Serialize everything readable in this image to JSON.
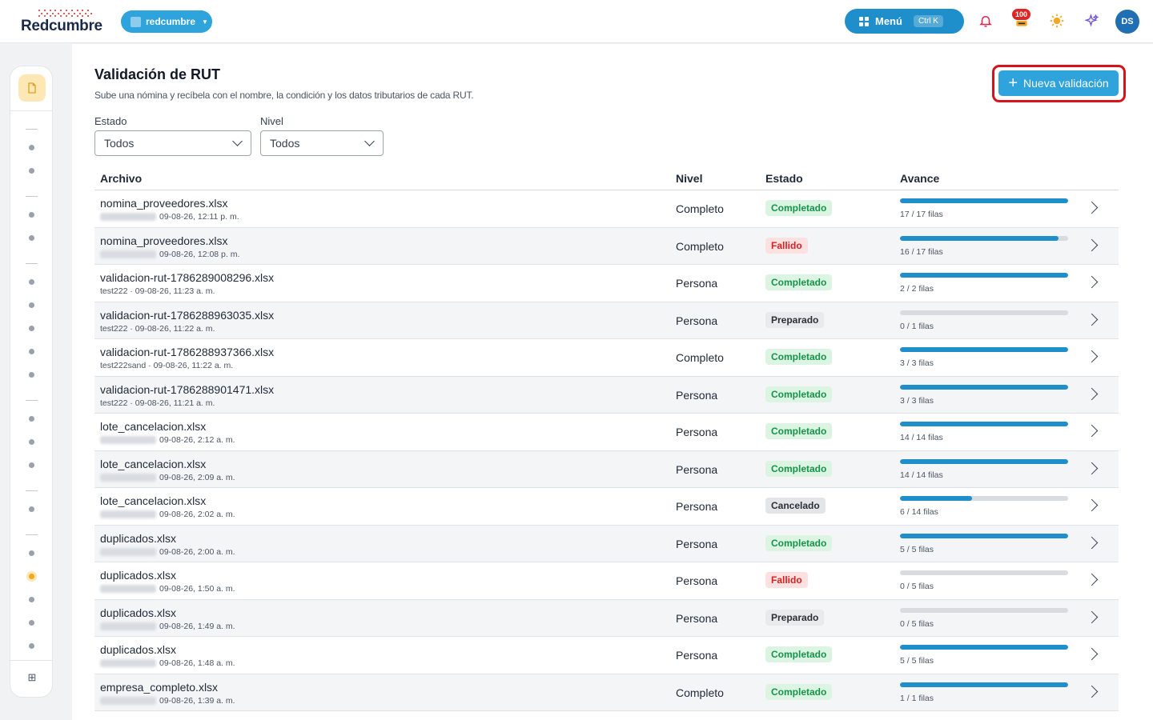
{
  "app": {
    "logo_text": "Redcumbre",
    "tenant": "redcumbre",
    "menu_label": "Menú",
    "menu_shortcut": "Ctrl K",
    "notifications_badge": "100",
    "user_initials": "DS"
  },
  "page": {
    "title": "Validación de RUT",
    "subtitle": "Sube una nómina y recíbela con el nombre, la condición y los datos tributarios de cada RUT.",
    "new_button": "Nueva validación"
  },
  "filters": {
    "estado_label": "Estado",
    "estado_value": "Todos",
    "nivel_label": "Nivel",
    "nivel_value": "Todos"
  },
  "table": {
    "headers": {
      "archivo": "Archivo",
      "nivel": "Nivel",
      "estado": "Estado",
      "avance": "Avance"
    },
    "rows": [
      {
        "file": "nomina_proveedores.xlsx",
        "owner": "",
        "date": "09-08-26, 12:11 p. m.",
        "level": "Completo",
        "status": "Completado",
        "status_kind": "ok",
        "done": 17,
        "total": 17,
        "progress_text": "17 / 17 filas"
      },
      {
        "file": "nomina_proveedores.xlsx",
        "owner": "",
        "date": "09-08-26, 12:08 p. m.",
        "level": "Completo",
        "status": "Fallido",
        "status_kind": "fail",
        "done": 16,
        "total": 17,
        "progress_text": "16 / 17 filas"
      },
      {
        "file": "validacion-rut-1786289008296.xlsx",
        "owner": "test222",
        "date": "09-08-26, 11:23 a. m.",
        "level": "Persona",
        "status": "Completado",
        "status_kind": "ok",
        "done": 2,
        "total": 2,
        "progress_text": "2 / 2 filas"
      },
      {
        "file": "validacion-rut-1786288963035.xlsx",
        "owner": "test222",
        "date": "09-08-26, 11:22 a. m.",
        "level": "Persona",
        "status": "Preparado",
        "status_kind": "prep",
        "done": 0,
        "total": 1,
        "progress_text": "0 / 1 filas"
      },
      {
        "file": "validacion-rut-1786288937366.xlsx",
        "owner": "test222sand",
        "date": "09-08-26, 11:22 a. m.",
        "level": "Completo",
        "status": "Completado",
        "status_kind": "ok",
        "done": 3,
        "total": 3,
        "progress_text": "3 / 3 filas"
      },
      {
        "file": "validacion-rut-1786288901471.xlsx",
        "owner": "test222",
        "date": "09-08-26, 11:21 a. m.",
        "level": "Persona",
        "status": "Completado",
        "status_kind": "ok",
        "done": 3,
        "total": 3,
        "progress_text": "3 / 3 filas"
      },
      {
        "file": "lote_cancelacion.xlsx",
        "owner": "",
        "date": "09-08-26, 2:12 a. m.",
        "level": "Persona",
        "status": "Completado",
        "status_kind": "ok",
        "done": 14,
        "total": 14,
        "progress_text": "14 / 14 filas"
      },
      {
        "file": "lote_cancelacion.xlsx",
        "owner": "",
        "date": "09-08-26, 2:09 a. m.",
        "level": "Persona",
        "status": "Completado",
        "status_kind": "ok",
        "done": 14,
        "total": 14,
        "progress_text": "14 / 14 filas"
      },
      {
        "file": "lote_cancelacion.xlsx",
        "owner": "",
        "date": "09-08-26, 2:02 a. m.",
        "level": "Persona",
        "status": "Cancelado",
        "status_kind": "cancel",
        "done": 6,
        "total": 14,
        "progress_text": "6 / 14 filas"
      },
      {
        "file": "duplicados.xlsx",
        "owner": "",
        "date": "09-08-26, 2:00 a. m.",
        "level": "Persona",
        "status": "Completado",
        "status_kind": "ok",
        "done": 5,
        "total": 5,
        "progress_text": "5 / 5 filas"
      },
      {
        "file": "duplicados.xlsx",
        "owner": "",
        "date": "09-08-26, 1:50 a. m.",
        "level": "Persona",
        "status": "Fallido",
        "status_kind": "fail",
        "done": 0,
        "total": 5,
        "progress_text": "0 / 5 filas"
      },
      {
        "file": "duplicados.xlsx",
        "owner": "",
        "date": "09-08-26, 1:49 a. m.",
        "level": "Persona",
        "status": "Preparado",
        "status_kind": "prep",
        "done": 0,
        "total": 5,
        "progress_text": "0 / 5 filas"
      },
      {
        "file": "duplicados.xlsx",
        "owner": "",
        "date": "09-08-26, 1:48 a. m.",
        "level": "Persona",
        "status": "Completado",
        "status_kind": "ok",
        "done": 5,
        "total": 5,
        "progress_text": "5 / 5 filas"
      },
      {
        "file": "empresa_completo.xlsx",
        "owner": "",
        "date": "09-08-26, 1:39 a. m.",
        "level": "Completo",
        "status": "Completado",
        "status_kind": "ok",
        "done": 1,
        "total": 1,
        "progress_text": "1 / 1 filas"
      }
    ]
  },
  "colors": {
    "accent": "#2ea3dc",
    "menu": "#1f8fcc",
    "highlight_outline": "#d9111a",
    "success": "#17924a",
    "danger": "#d61f1f"
  },
  "icons": {
    "sidebar_active": "document-icon",
    "sidebar_bottom": "grid-icon",
    "notifications": "bell-icon",
    "theme": "sun-icon",
    "ai": "sparkle-icon"
  }
}
